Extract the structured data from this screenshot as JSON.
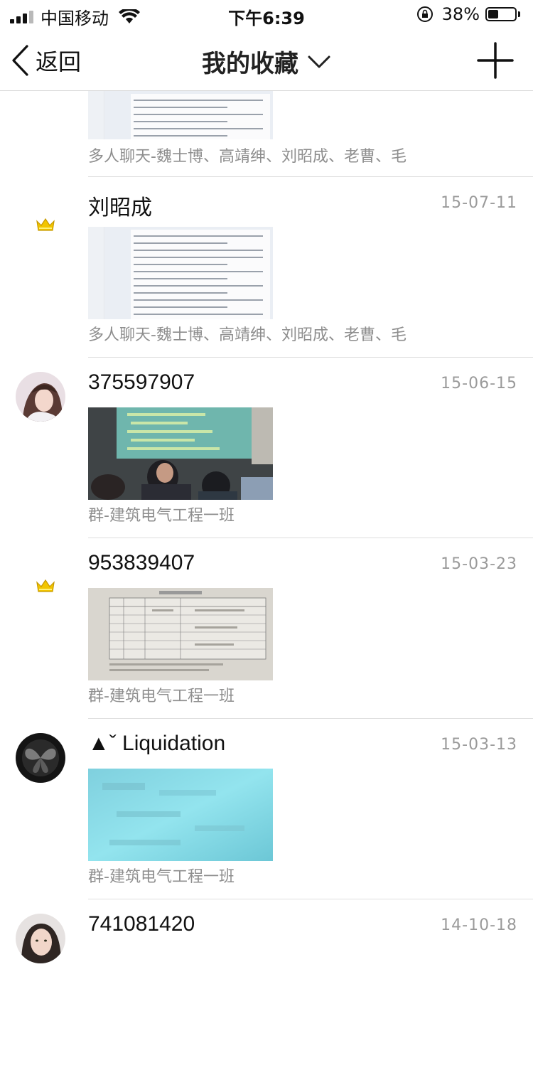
{
  "status_bar": {
    "carrier": "中国移动",
    "time": "下午6:39",
    "battery_percent": "38%",
    "battery_level": 0.38
  },
  "nav": {
    "back_label": "返回",
    "title": "我的收藏"
  },
  "favorites": [
    {
      "name": "",
      "date": "",
      "source": "多人聊天-魏士博、高靖绅、刘昭成、老曹、毛",
      "thumb_kind": "document",
      "avatar": "none"
    },
    {
      "name": "刘昭成",
      "date": "15-07-11",
      "source": "多人聊天-魏士博、高靖绅、刘昭成、老曹、毛",
      "thumb_kind": "document",
      "avatar": "crown"
    },
    {
      "name": "375597907",
      "date": "15-06-15",
      "source": "群-建筑电气工程一班",
      "thumb_kind": "classroom",
      "avatar": "photo-girl"
    },
    {
      "name": "953839407",
      "date": "15-03-23",
      "source": "群-建筑电气工程一班",
      "thumb_kind": "table",
      "avatar": "crown"
    },
    {
      "name": "▲ˇ Liquidation",
      "date": "15-03-13",
      "source": "群-建筑电气工程一班",
      "thumb_kind": "blurred",
      "avatar": "photo-butterfly"
    },
    {
      "name": "741081420",
      "date": "14-10-18",
      "source": "",
      "thumb_kind": "none",
      "avatar": "photo-woman"
    }
  ],
  "colors": {
    "crown": "#f2c500",
    "date": "#9a9a9a",
    "source": "#8e8e8e",
    "separator": "#dedede"
  }
}
